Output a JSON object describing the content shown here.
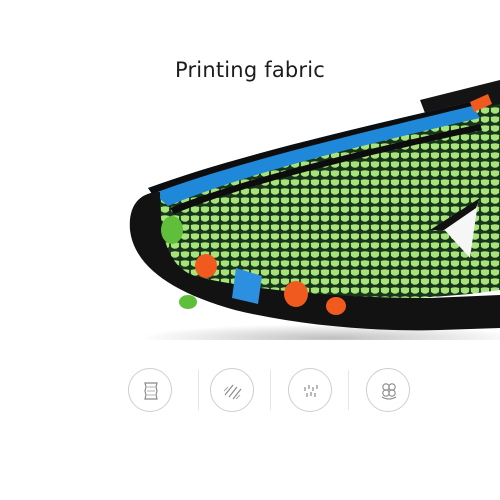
{
  "heading": "Printing fabric",
  "product": {
    "colors": {
      "mesh": "#a8e27a",
      "mesh_dark": "#16351a",
      "sole": "#121212",
      "stripe_blue": "#1f88d8",
      "accent_orange": "#f05a1e",
      "accent_green": "#5fbf3a",
      "accent_blue": "#2d8fe0"
    }
  },
  "feature_icons": [
    "fabric-swatch-icon",
    "fiber-strands-icon",
    "texture-dots-icon",
    "knit-pattern-icon"
  ]
}
